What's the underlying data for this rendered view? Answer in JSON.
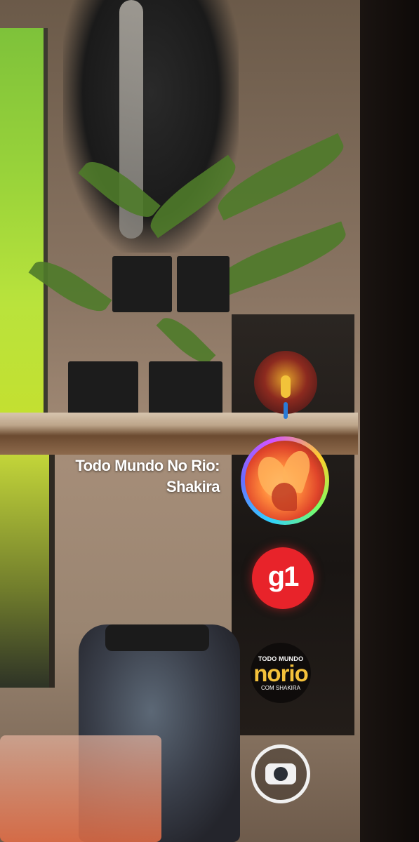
{
  "overlay": {
    "focused_channel": {
      "title_line1": "Todo Mundo No Rio:",
      "title_line2": "Shakira"
    },
    "channels": [
      {
        "id": "festival",
        "icon": "festival-stage-icon"
      },
      {
        "id": "todo-mundo-no-rio-shakira",
        "icon": "shakira-thumbnail-icon",
        "selected": true
      },
      {
        "id": "g1",
        "label": "g1",
        "icon": "g1-logo-icon",
        "color": "#e8232a"
      },
      {
        "id": "norio",
        "icon": "todo-mundo-no-rio-logo-icon",
        "top": "TODO MUNDO",
        "main": "norio",
        "bottom": "COM SHAKIRA",
        "accent": "#f4c13b"
      },
      {
        "id": "globoplay",
        "icon": "globo-screen-icon"
      }
    ]
  }
}
